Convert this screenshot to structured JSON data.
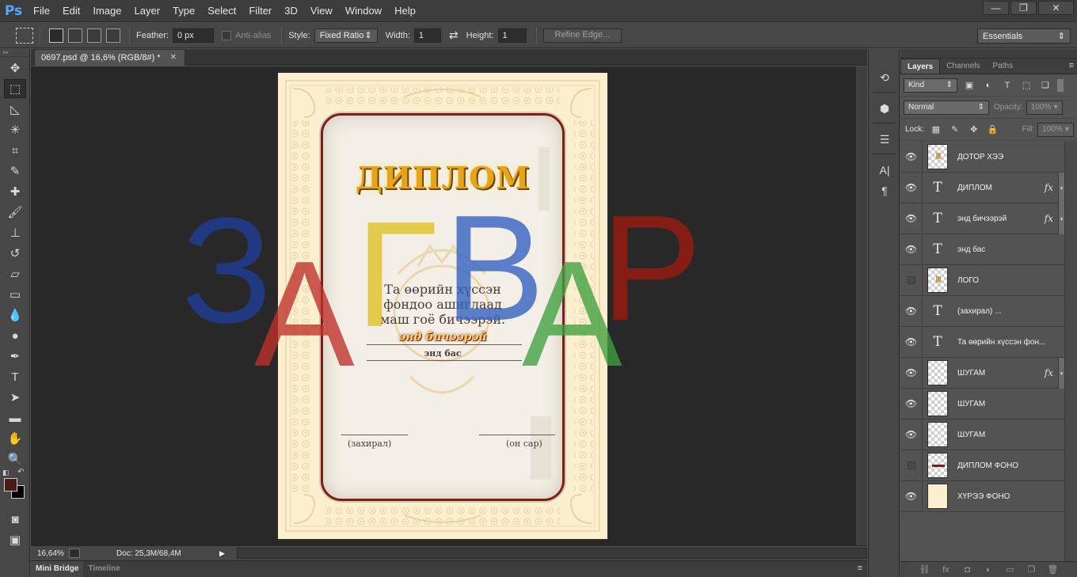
{
  "app": {
    "logo": "Ps"
  },
  "menu": [
    "File",
    "Edit",
    "Image",
    "Layer",
    "Type",
    "Select",
    "Filter",
    "3D",
    "View",
    "Window",
    "Help"
  ],
  "window_controls": {
    "minimize": "—",
    "restore": "❐",
    "close": "✕"
  },
  "options_bar": {
    "feather_label": "Feather:",
    "feather_value": "0 px",
    "antialias_label": "Anti-alias",
    "style_label": "Style:",
    "style_value": "Fixed Ratio",
    "width_label": "Width:",
    "width_value": "1",
    "height_label": "Height:",
    "height_value": "1",
    "refine_edge": "Refine Edge...",
    "workspace": "Essentials"
  },
  "document": {
    "tab_title": "0697.psd @ 16,6% (RGB/8#) *",
    "zoom": "16,64%",
    "doc_size": "Doc: 25,3M/68,4M"
  },
  "bottom_tabs": [
    "Mini Bridge",
    "Timeline"
  ],
  "diploma": {
    "title": "ДИПЛОМ",
    "body_lines": [
      "Та өөрийн хүссэн",
      "фондоо ашиглаад",
      "маш гоё бичээрэй."
    ],
    "italic_line": "энд бичээрэй",
    "small_line": "энд бас",
    "sign_left": "(захирал)",
    "sign_right": "(он сар)"
  },
  "watermark": {
    "letters": [
      {
        "char": "З",
        "color": "#1f3f9a"
      },
      {
        "char": "А",
        "color": "#c0302a"
      },
      {
        "char": "Г",
        "color": "#e0c020"
      },
      {
        "char": "В",
        "color": "#3060c0"
      },
      {
        "char": "А",
        "color": "#40a040"
      },
      {
        "char": "Р",
        "color": "#a01a10"
      }
    ]
  },
  "layers_panel": {
    "tabs": [
      "Layers",
      "Channels",
      "Paths"
    ],
    "filter_kind": "Kind",
    "blend_mode": "Normal",
    "opacity_label": "Opacity:",
    "opacity_value": "100%",
    "lock_label": "Lock:",
    "fill_label": "Fill:",
    "fill_value": "100%",
    "layers": [
      {
        "name": "ДОТОР ХЭЭ",
        "type": "pixel",
        "visible": true,
        "fx": false
      },
      {
        "name": "ДИПЛОМ",
        "type": "text",
        "visible": true,
        "fx": true
      },
      {
        "name": "энд бичээрэй",
        "type": "text",
        "visible": true,
        "fx": true
      },
      {
        "name": "энд бас",
        "type": "text",
        "visible": true,
        "fx": false
      },
      {
        "name": "ЛОГО",
        "type": "pixel",
        "visible": false,
        "fx": false
      },
      {
        "name": "(захирал)          ...",
        "type": "text",
        "visible": true,
        "fx": false
      },
      {
        "name": "Та өөрийн хүссэн фон...",
        "type": "text",
        "visible": true,
        "fx": false
      },
      {
        "name": "ШУГАМ",
        "type": "pixel",
        "visible": true,
        "fx": true
      },
      {
        "name": "ШУГАМ",
        "type": "pixel",
        "visible": true,
        "fx": false
      },
      {
        "name": "ШУГАМ",
        "type": "pixel",
        "visible": true,
        "fx": false
      },
      {
        "name": "ДИПЛОМ ФОНО",
        "type": "pixel-red",
        "visible": false,
        "fx": false
      },
      {
        "name": "ХҮРЭЭ ФОНО",
        "type": "pixel-bg",
        "visible": true,
        "fx": false
      }
    ]
  }
}
